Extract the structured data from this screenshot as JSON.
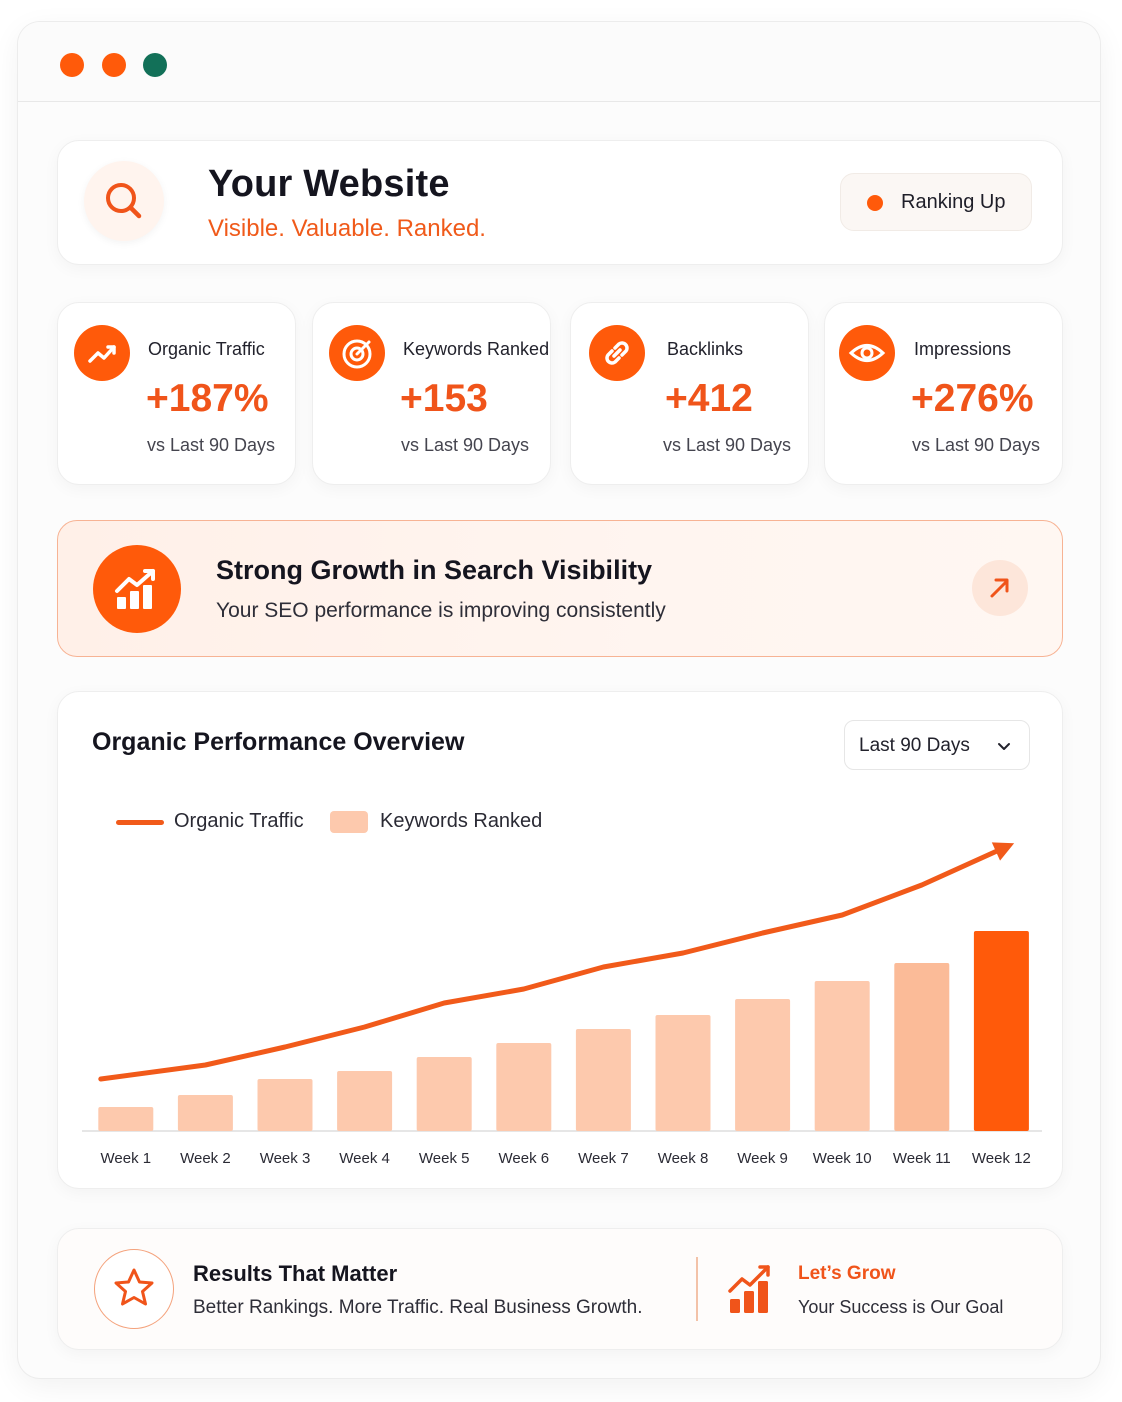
{
  "window": {
    "controls": [
      {
        "name": "close",
        "color": "#ff5a0a"
      },
      {
        "name": "minimize",
        "color": "#ff5a0a"
      },
      {
        "name": "maximize",
        "color": "#127058"
      }
    ]
  },
  "header": {
    "title": "Your Website",
    "tagline": "Visible. Valuable. Ranked.",
    "icon": "search-icon",
    "status_badge": {
      "label": "Ranking Up",
      "dot_color": "#ff5a0a"
    }
  },
  "stats": [
    {
      "label": "Organic Traffic",
      "value": "+187%",
      "sub": "vs Last 90 Days",
      "icon": "trend-up-icon"
    },
    {
      "label": "Keywords Ranked",
      "value": "+153",
      "sub": "vs Last 90 Days",
      "icon": "target-icon"
    },
    {
      "label": "Backlinks",
      "value": "+412",
      "sub": "vs Last 90 Days",
      "icon": "link-icon"
    },
    {
      "label": "Impressions",
      "value": "+276%",
      "sub": "vs Last 90 Days",
      "icon": "eye-icon"
    }
  ],
  "banner": {
    "title": "Strong Growth in Search Visibility",
    "subtitle": "Your SEO performance is improving consistently",
    "icon": "growth-chart-icon",
    "action_icon": "arrow-up-right-icon"
  },
  "overview": {
    "title": "Organic Performance Overview",
    "range_select": {
      "value": "Last 90 Days",
      "icon": "chevron-down-icon"
    }
  },
  "chart_data": {
    "type": "bar",
    "categories": [
      "Week 1",
      "Week 2",
      "Week 3",
      "Week 4",
      "Week 5",
      "Week 6",
      "Week 7",
      "Week 8",
      "Week 9",
      "Week 10",
      "Week 11",
      "Week 12"
    ],
    "series": [
      {
        "name": "Keywords Ranked",
        "type": "bar",
        "values": [
          12,
          18,
          26,
          30,
          37,
          44,
          51,
          58,
          66,
          75,
          84,
          100
        ],
        "color": "#fdc9ad",
        "highlight_color": "#ff5a0a",
        "highlight_last": true
      },
      {
        "name": "Organic Traffic",
        "type": "line",
        "values": [
          26,
          33,
          42,
          52,
          64,
          71,
          82,
          89,
          99,
          108,
          123,
          141
        ],
        "color": "#f15a1a",
        "arrow_end": true
      }
    ],
    "ylim": [
      0,
      150
    ],
    "grid": false,
    "legend": "top-left",
    "title": "",
    "xlabel": "",
    "ylabel": ""
  },
  "footer": {
    "title": "Results That Matter",
    "subtitle": "Better Rankings. More Traffic. Real Business Growth.",
    "icon": "star-icon",
    "cta": {
      "title": "Let’s Grow",
      "subtitle": "Your Success is Our Goal",
      "icon": "bar-growth-icon"
    }
  }
}
